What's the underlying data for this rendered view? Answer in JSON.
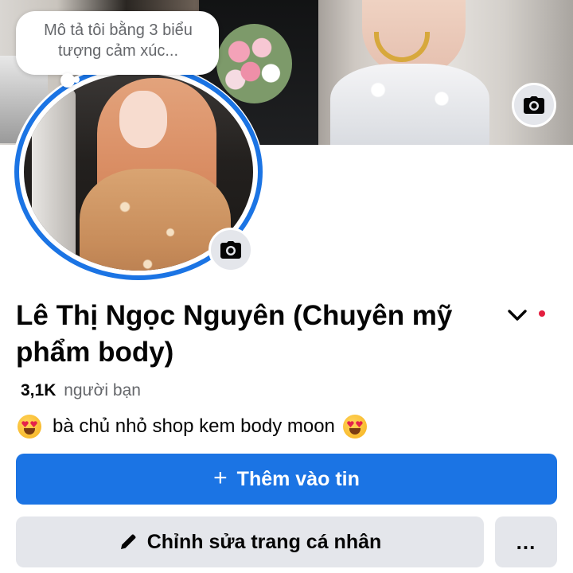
{
  "profile": {
    "note": "Mô tả tôi bằng 3 biểu tượng cảm xúc...",
    "name": "Lê Thị Ngọc Nguyên (Chuyên mỹ phẩm body)",
    "friends_count": "3,1K",
    "friends_label": "người bạn",
    "bio": "bà chủ nhỏ shop kem body moon",
    "bio_emoji": "smiling-face-with-heart-eyes-emoji"
  },
  "actions": {
    "add_story_label": "Thêm vào tin",
    "edit_profile_label": "Chỉnh sửa trang cá nhân",
    "more_label": "..."
  },
  "icons": {
    "cover_camera": "camera-icon",
    "avatar_camera": "camera-icon",
    "name_dropdown": "chevron-down-icon",
    "notification": "red-dot",
    "add": "plus-icon",
    "edit": "pencil-icon"
  },
  "colors": {
    "primary": "#1b74e4",
    "secondary_bg": "#e4e6eb",
    "text": "#050505",
    "muted": "#65676b",
    "notification_dot": "#e41e3f"
  }
}
